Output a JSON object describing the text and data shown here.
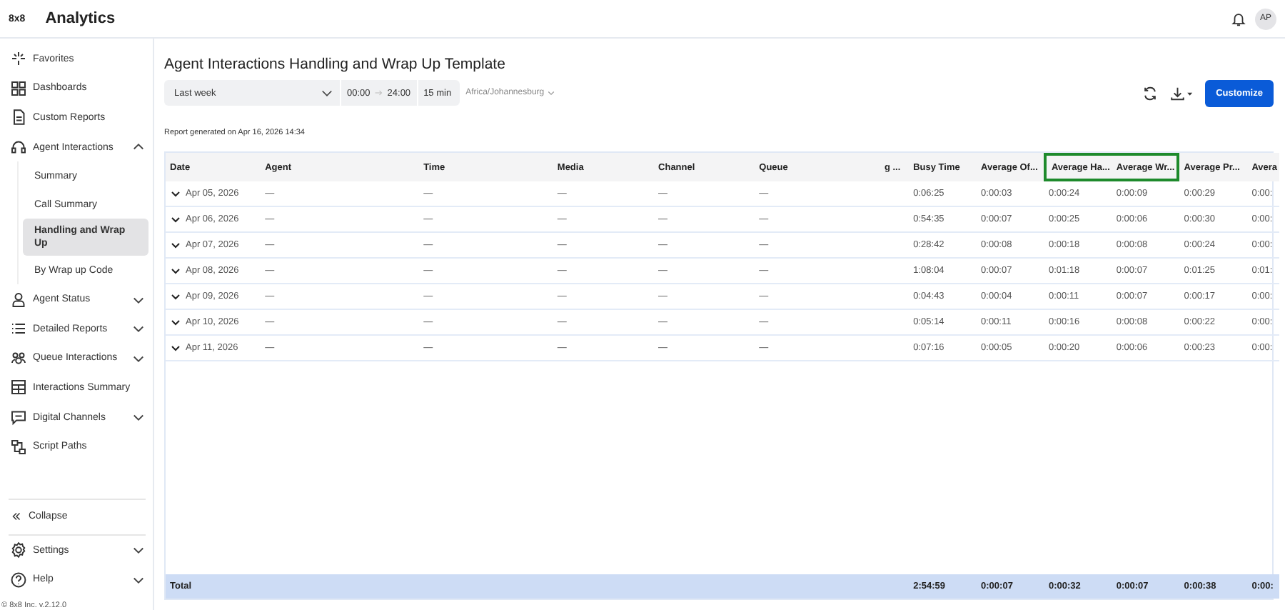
{
  "header": {
    "logo": "8x8",
    "title": "Analytics",
    "avatar": "AP"
  },
  "sidebar": {
    "items": [
      {
        "label": "Favorites"
      },
      {
        "label": "Dashboards"
      },
      {
        "label": "Custom Reports"
      },
      {
        "label": "Agent Interactions",
        "expanded": true,
        "children": [
          {
            "label": "Summary",
            "selected": false
          },
          {
            "label": "Call Summary",
            "selected": false
          },
          {
            "label": "Handling and Wrap Up",
            "selected": true
          },
          {
            "label": "By Wrap up Code",
            "selected": false
          }
        ]
      },
      {
        "label": "Agent Status",
        "expanded": false
      },
      {
        "label": "Detailed Reports",
        "expanded": false
      },
      {
        "label": "Queue Interactions",
        "expanded": false
      },
      {
        "label": "Interactions Summary"
      },
      {
        "label": "Digital Channels",
        "expanded": false
      },
      {
        "label": "Script Paths"
      }
    ],
    "collapse": "Collapse",
    "bottom_items": [
      {
        "label": "Settings",
        "expanded": false
      },
      {
        "label": "Help",
        "expanded": false
      }
    ],
    "footer": "© 8x8 Inc. v.2.12.0"
  },
  "report": {
    "title": "Agent Interactions Handling and Wrap Up Template",
    "period": "Last week",
    "time_from": "00:00",
    "time_to": "24:00",
    "interval": "15 min",
    "timezone": "Africa/Johannesburg",
    "customize": "Customize",
    "generated": "Report generated on Apr 16, 2026 14:34"
  },
  "table": {
    "columns": [
      {
        "label": "Date",
        "highlighted": false
      },
      {
        "label": "Agent",
        "highlighted": false
      },
      {
        "label": "Time",
        "highlighted": false
      },
      {
        "label": "Media",
        "highlighted": false
      },
      {
        "label": "Channel",
        "highlighted": false
      },
      {
        "label": "Queue",
        "highlighted": false
      },
      {
        "label": "g ...",
        "highlighted": false
      },
      {
        "label": "Busy Time",
        "highlighted": false
      },
      {
        "label": "Average Of...",
        "highlighted": false
      },
      {
        "label": "Average Ha...",
        "highlighted": true
      },
      {
        "label": "Average Wr...",
        "highlighted": true
      },
      {
        "label": "Average Pr...",
        "highlighted": false
      },
      {
        "label": "Avera",
        "highlighted": false
      }
    ],
    "rows": [
      {
        "expanded": false,
        "cells": [
          "Apr 05, 2026",
          "—",
          "—",
          "—",
          "—",
          "—",
          "",
          "0:06:25",
          "0:00:03",
          "0:00:24",
          "0:00:09",
          "0:00:29",
          "0:00:"
        ]
      },
      {
        "expanded": false,
        "cells": [
          "Apr 06, 2026",
          "—",
          "—",
          "—",
          "—",
          "—",
          "",
          "0:54:35",
          "0:00:07",
          "0:00:25",
          "0:00:06",
          "0:00:30",
          "0:00:"
        ]
      },
      {
        "expanded": false,
        "cells": [
          "Apr 07, 2026",
          "—",
          "—",
          "—",
          "—",
          "—",
          "",
          "0:28:42",
          "0:00:08",
          "0:00:18",
          "0:00:08",
          "0:00:24",
          "0:00:"
        ]
      },
      {
        "expanded": false,
        "cells": [
          "Apr 08, 2026",
          "—",
          "—",
          "—",
          "—",
          "—",
          "",
          "1:08:04",
          "0:00:07",
          "0:01:18",
          "0:00:07",
          "0:01:25",
          "0:01:"
        ]
      },
      {
        "expanded": false,
        "cells": [
          "Apr 09, 2026",
          "—",
          "—",
          "—",
          "—",
          "—",
          "",
          "0:04:43",
          "0:00:04",
          "0:00:11",
          "0:00:07",
          "0:00:17",
          "0:00:"
        ]
      },
      {
        "expanded": false,
        "cells": [
          "Apr 10, 2026",
          "—",
          "—",
          "—",
          "—",
          "—",
          "",
          "0:05:14",
          "0:00:11",
          "0:00:16",
          "0:00:08",
          "0:00:22",
          "0:00:"
        ]
      },
      {
        "expanded": false,
        "cells": [
          "Apr 11, 2026",
          "—",
          "—",
          "—",
          "—",
          "—",
          "",
          "0:07:16",
          "0:00:05",
          "0:00:20",
          "0:00:06",
          "0:00:23",
          "0:00:"
        ]
      }
    ],
    "total": {
      "cells": [
        "Total",
        "",
        "",
        "",
        "",
        "",
        "",
        "2:54:59",
        "0:00:07",
        "0:00:32",
        "0:00:07",
        "0:00:38",
        "0:00:"
      ]
    }
  }
}
